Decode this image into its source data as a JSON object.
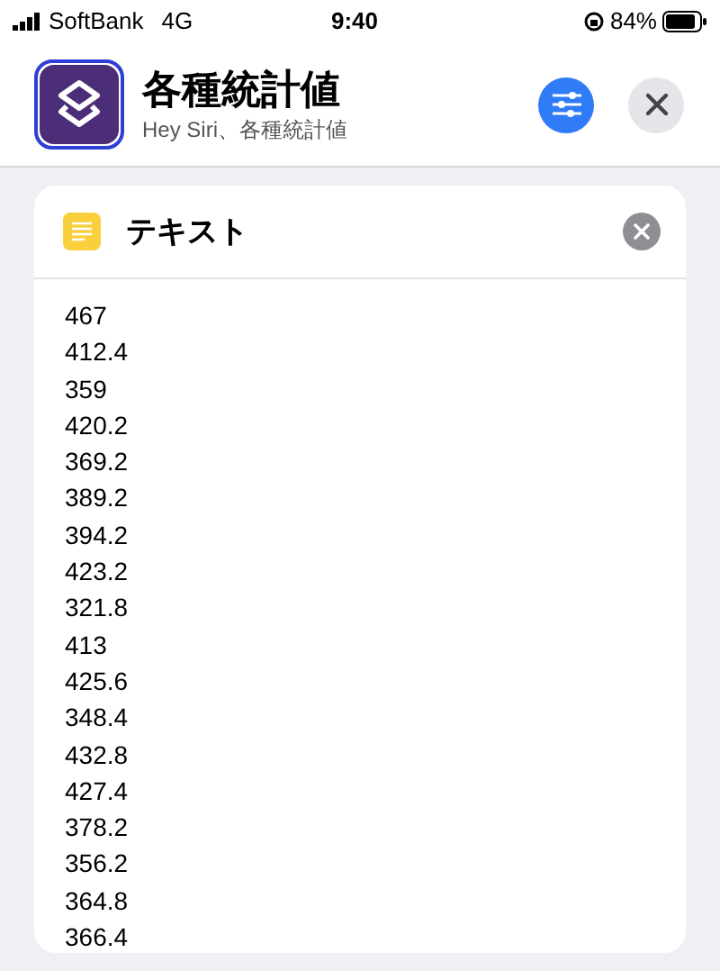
{
  "status_bar": {
    "carrier": "SoftBank",
    "network": "4G",
    "time": "9:40",
    "battery": "84%"
  },
  "header": {
    "title": "各種統計値",
    "subtitle": "Hey Siri、各種統計値"
  },
  "card": {
    "title": "テキスト",
    "lines": [
      "467",
      "412.4",
      "359",
      "420.2",
      "369.2",
      "389.2",
      "394.2",
      "423.2",
      "321.8",
      "413",
      "425.6",
      "348.4",
      "432.8",
      "427.4",
      "378.2",
      "356.2",
      "364.8",
      "366.4"
    ]
  }
}
